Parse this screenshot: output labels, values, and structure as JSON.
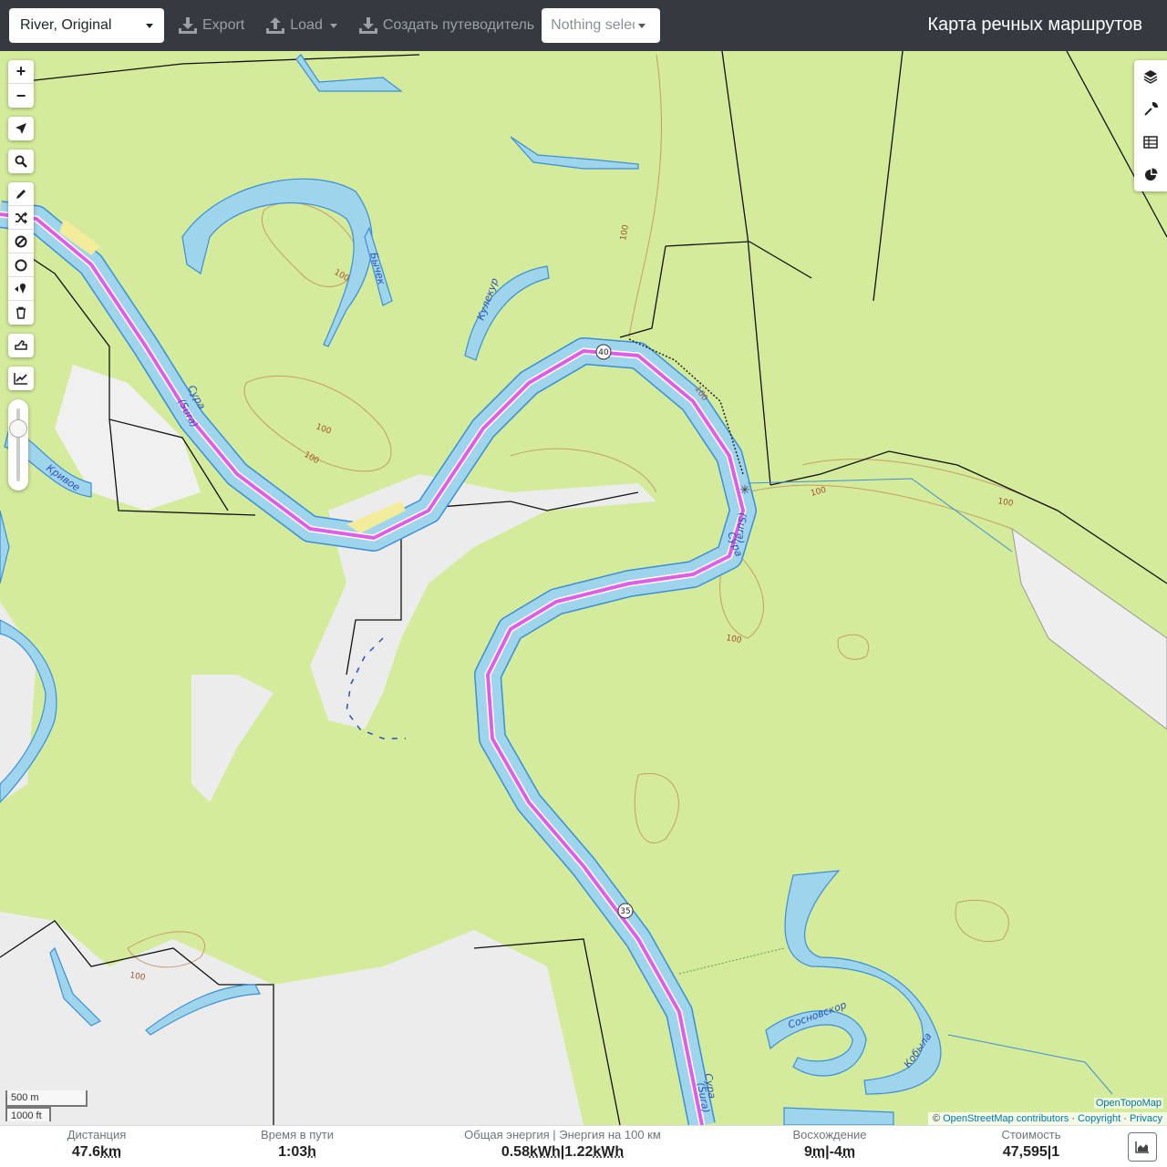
{
  "header": {
    "profile": "River, Original",
    "export_label": "Export",
    "load_label": "Load",
    "guide_label": "Создать путеводитель",
    "route_select_placeholder": "Nothing selected",
    "brand": "Карта речных маршрутов"
  },
  "map": {
    "labels": {
      "sura_1": "Сура",
      "sura_1b": "(Sura)",
      "sura_2": "Сура",
      "sura_2b": "(Sura)",
      "sura_3": "Сура",
      "sura_3b": "(Sura)",
      "bychek": "Бычек",
      "kulekur": "Кулекур",
      "krivoe": "Кривое",
      "sosnovskor": "Сосновскор",
      "kobyla": "Кобыла"
    },
    "contour_labels": [
      "100",
      "100",
      "100",
      "100",
      "100",
      "100",
      "100",
      "100",
      "100"
    ],
    "km_markers": [
      "40",
      "35"
    ],
    "scale_metric": "500 m",
    "scale_imperial": "1000 ft",
    "tile_credit": "OpenTopoMap",
    "attribution": {
      "prefix": "©",
      "osm": "OpenStreetMap contributors",
      "sep1": "·",
      "copyright": "Copyright",
      "sep2": "·",
      "privacy": "Privacy"
    }
  },
  "icons": {
    "zoom_in": "plus-icon",
    "zoom_out": "minus-icon",
    "locate": "location-arrow-icon",
    "search": "search-icon",
    "draw": "pencil-icon",
    "shuffle": "shuffle-icon",
    "nogo": "no-go-icon",
    "circle": "circle-icon",
    "poi": "marker-icon",
    "delete": "trash-icon",
    "hand": "hand-icon",
    "chart": "line-chart-icon",
    "layers": "layers-icon",
    "settings": "wrench-icon",
    "table": "table-icon",
    "pie": "pie-chart-icon"
  },
  "stats": {
    "distance_label": "Дистанция",
    "distance_value": "47.6",
    "distance_unit": "km",
    "time_label": "Время в пути",
    "time_value": "1:03",
    "time_unit": "h",
    "energy_label": "Общая энергия | Энергия на 100 км",
    "energy_value1": "0.58",
    "energy_unit1": "kWh",
    "energy_sep": "|",
    "energy_value2": "1.22",
    "energy_unit2": "kWh",
    "ascent_label": "Восхождение",
    "ascent_value1": "9",
    "ascent_unit1": "m",
    "ascent_sep": "|",
    "ascent_value2": "-4",
    "ascent_unit2": "m",
    "cost_label": "Стоимость",
    "cost_value1": "47,595",
    "cost_sep": "|",
    "cost_value2": "1"
  },
  "colors": {
    "navbar": "#343a40",
    "forest": "#d4eb9b",
    "water": "#9fd4ed",
    "water_edge": "#3b8ed8",
    "route": "#e05ee6",
    "contour": "#a0522d",
    "bare": "#e8e8e8"
  }
}
